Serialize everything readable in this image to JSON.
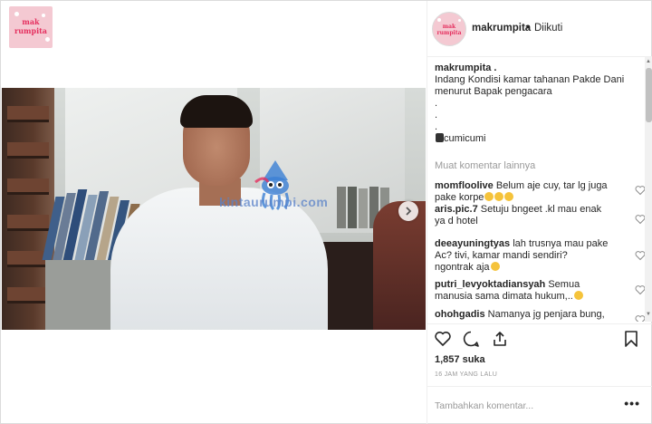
{
  "corner_logo": {
    "line1": "mak",
    "line2": "rumpita"
  },
  "header": {
    "username": "makrumpita",
    "separator": "•",
    "follow_status": "Diikuti"
  },
  "video": {
    "watermark": "kintaurumpi.com"
  },
  "caption": {
    "username": "makrumpita .",
    "lines": [
      "Indang Kondisi kamar tahanan Pakde Dani",
      "menurut Bapak pengacara",
      ".",
      ".",
      ".",
      "cumicumi"
    ]
  },
  "load_more": "Muat komentar lainnya",
  "comments": [
    {
      "user": "momfloolive",
      "text": "Belum aje cuy, tar lg juga",
      "text2": "pake korpe"
    },
    {
      "user": "aris.pic.7",
      "text": "Setuju bngeet .kl mau enak",
      "text2": "ya d hotel"
    },
    {
      "user": "deeayuningtyas",
      "text": "lah trusnya mau pake",
      "text2": "Ac? tivi, kamar mandi sendiri?",
      "text3": "ngontrak aja"
    },
    {
      "user": "putri_levyoktadiansyah",
      "text": "Semua",
      "text2": "manusia sama dimata hukum,.."
    },
    {
      "user": "ohohgadis",
      "text": "Namanya jg penjara bung,"
    }
  ],
  "likes": "1,857 suka",
  "timestamp": "16 JAM YANG LALU",
  "add_comment_placeholder": "Tambahkan komentar...",
  "add_comment_more": "•••",
  "colors": {
    "brand_pink": "#e5305f",
    "text": "#262626",
    "muted": "#999999",
    "border": "#efefef"
  }
}
